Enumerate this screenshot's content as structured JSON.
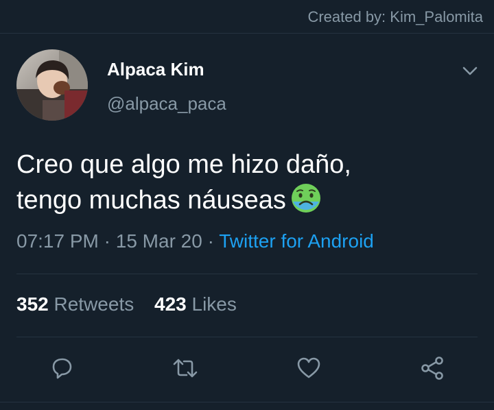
{
  "watermark": {
    "text": "Created by: Kim_Palomita"
  },
  "author": {
    "display_name": "Alpaca Kim",
    "handle": "@alpaca_paca"
  },
  "tweet": {
    "line1": "Creo que algo me hizo daño,",
    "line2": "tengo muchas náuseas",
    "emoji": "nauseated-face"
  },
  "meta": {
    "time": "07:17 PM",
    "separator1": " · ",
    "date": "15 Mar 20",
    "separator2": " · ",
    "source": "Twitter for Android"
  },
  "stats": {
    "retweets_count": "352",
    "retweets_label": "Retweets",
    "likes_count": "423",
    "likes_label": "Likes"
  },
  "actions": [
    "reply-icon",
    "retweet-icon",
    "like-icon",
    "share-icon"
  ],
  "colors": {
    "background": "#15202b",
    "text": "#ffffff",
    "secondary": "#8899a6",
    "link": "#1da1f2",
    "divider": "#253341"
  }
}
